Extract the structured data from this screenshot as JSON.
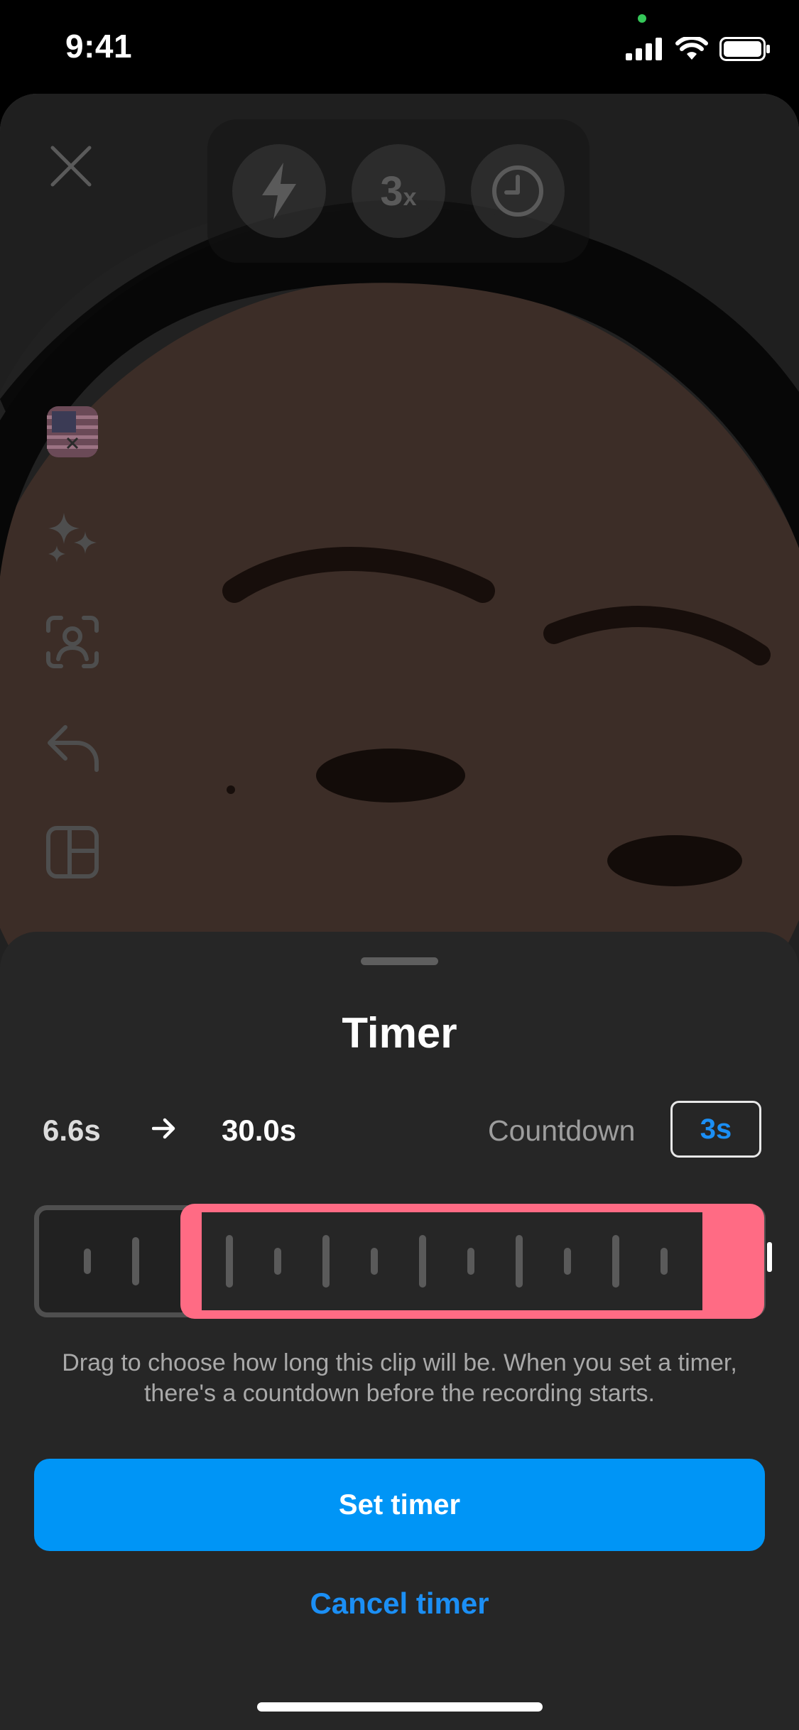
{
  "status_bar": {
    "time": "9:41"
  },
  "camera": {
    "top_controls": [
      {
        "name": "flash",
        "icon": "flash-icon"
      },
      {
        "name": "speed",
        "label": "3",
        "suffix": "x"
      },
      {
        "name": "timer",
        "icon": "clock-icon"
      }
    ],
    "side_tools": [
      "flag-filter-icon",
      "effects-sparkle-icon",
      "green-screen-icon",
      "undo-icon",
      "layout-icon"
    ]
  },
  "sheet": {
    "title": "Timer",
    "duration_start": "6.6s",
    "duration_end": "30.0s",
    "countdown_label": "Countdown",
    "countdown_value": "3s",
    "helper_text": "Drag to choose how long this clip will be. When you set a timer, there's a countdown before the recording starts.",
    "primary_button": "Set timer",
    "secondary_button": "Cancel timer"
  },
  "colors": {
    "accent_blue": "#0095f6",
    "link_blue": "#1b8ff5",
    "selection_pink": "#ff6b84",
    "sheet_bg": "#262626"
  }
}
